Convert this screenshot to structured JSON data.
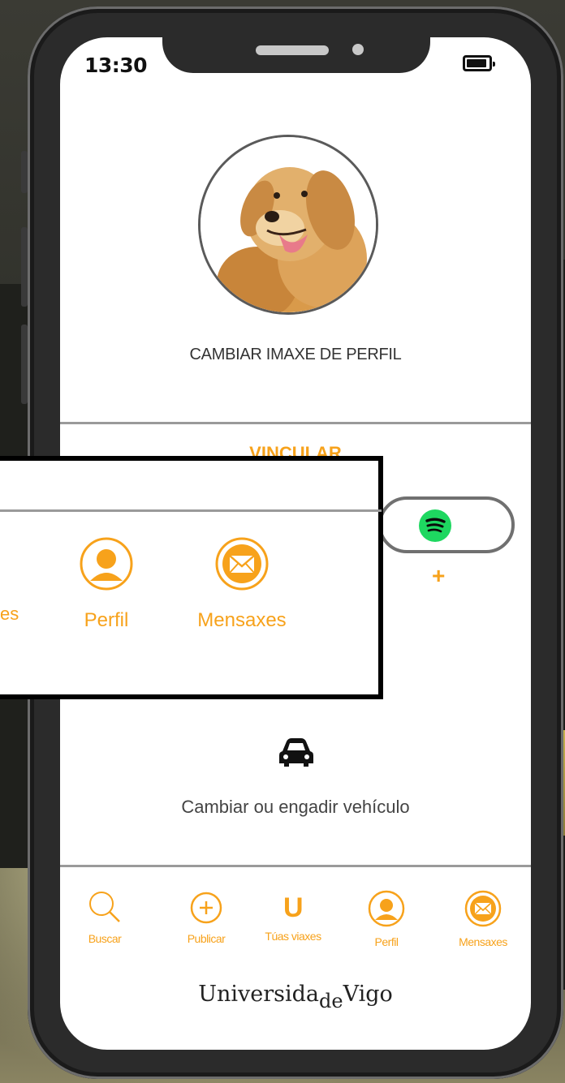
{
  "status_bar": {
    "time": "13:30"
  },
  "profile": {
    "change_photo_label": "CAMBIAR IMAXE DE PERFIL"
  },
  "link_section": {
    "title": "VINCULAR",
    "spotify_add": "+"
  },
  "vehicle": {
    "label": "Cambiar ou engadir vehículo",
    "icon": "car-icon"
  },
  "nav": {
    "items": [
      {
        "label": "Buscar",
        "icon": "search-icon"
      },
      {
        "label": "Publicar",
        "icon": "plus-circle-icon"
      },
      {
        "label": "Túas viaxes",
        "icon": "u-icon",
        "glyph": "U"
      },
      {
        "label": "Perfil",
        "icon": "user-icon"
      },
      {
        "label": "Mensaxes",
        "icon": "mail-icon"
      }
    ]
  },
  "university": {
    "name_start": "Universida",
    "name_sub": "de",
    "name_end": "Vigo"
  },
  "zoom_overlay": {
    "partial_label": "es",
    "items": [
      {
        "label": "Perfil",
        "icon": "user-icon"
      },
      {
        "label": "Mensaxes",
        "icon": "mail-icon"
      }
    ]
  },
  "colors": {
    "accent": "#f7a21b",
    "spotify": "#1ed760"
  }
}
